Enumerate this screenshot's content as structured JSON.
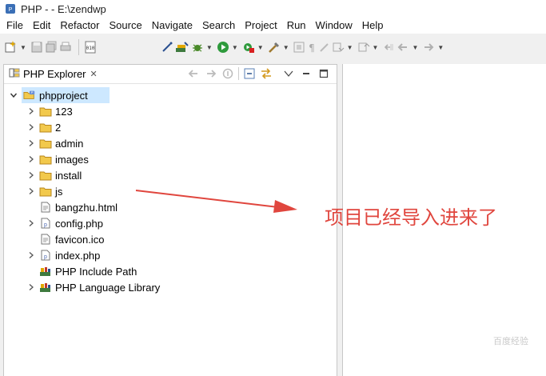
{
  "window": {
    "title": "PHP -  - E:\\zendwp"
  },
  "menu": [
    "File",
    "Edit",
    "Refactor",
    "Source",
    "Navigate",
    "Search",
    "Project",
    "Run",
    "Window",
    "Help"
  ],
  "explorer": {
    "tab_label": "PHP Explorer",
    "tab_close": "✕",
    "root": {
      "label": "phpproject",
      "expanded": true
    },
    "items": [
      {
        "label": "123",
        "type": "folder",
        "expandable": true
      },
      {
        "label": "2",
        "type": "folder",
        "expandable": true
      },
      {
        "label": "admin",
        "type": "folder",
        "expandable": true
      },
      {
        "label": "images",
        "type": "folder",
        "expandable": true
      },
      {
        "label": "install",
        "type": "folder",
        "expandable": true
      },
      {
        "label": "js",
        "type": "folder",
        "expandable": true
      },
      {
        "label": "bangzhu.html",
        "type": "file",
        "expandable": false
      },
      {
        "label": "config.php",
        "type": "php",
        "expandable": true
      },
      {
        "label": "favicon.ico",
        "type": "file",
        "expandable": false
      },
      {
        "label": "index.php",
        "type": "php",
        "expandable": true
      },
      {
        "label": "PHP Include Path",
        "type": "library",
        "expandable": false
      },
      {
        "label": "PHP Language Library",
        "type": "library",
        "expandable": true
      }
    ]
  },
  "annotation": {
    "text": "项目已经导入进来了",
    "color": "#e0463e"
  },
  "watermark": "百度经验",
  "colors": {
    "selection": "#cde8ff",
    "folder": "#e8b84a",
    "arrow": "#e0463e"
  }
}
